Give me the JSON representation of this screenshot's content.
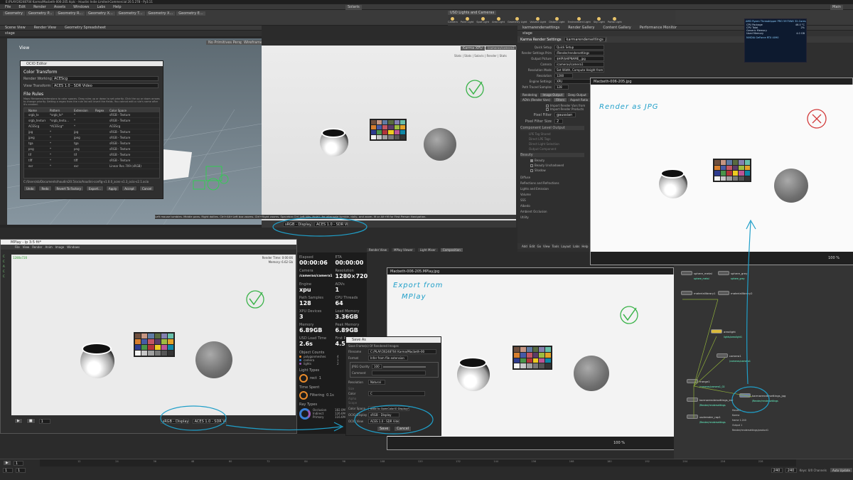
{
  "window": {
    "title": "E:/PLAY/26248704 Karma/Macbeth-006-205.hiplc - Houdini Indie Limited-Commercial 20.5.278 - Py3.11",
    "menus": [
      "File",
      "Edit",
      "Render",
      "Assets",
      "Windows",
      "Labs",
      "Help"
    ],
    "desktop": "Solaris",
    "build": "Main",
    "shelf_tabs": [
      "Geometry",
      "Geometry P...",
      "Geometry R...",
      "Geometry X...",
      "Geometry T...",
      "Geometry X...",
      "Geometry E..."
    ],
    "shelf_tabs_right": [
      "USD Lights and Cameras"
    ],
    "shelf_tools": [
      "Camera",
      "Point Light",
      "Spot Light",
      "Area Light",
      "Geometry Light",
      "Volume Light",
      "Distant Light",
      "Environment Light",
      "Sky Light",
      "Portal Light"
    ]
  },
  "top_left_pane": {
    "tabs": [
      "Scene View",
      "Render View",
      "Geometry Spreadsheet"
    ],
    "path": "stage",
    "view_label": "View",
    "hud_left": "No Primitives Persp",
    "hud_right": "Wireframe"
  },
  "ocio_editor": {
    "title": "OCIO Editor",
    "section": "Color Transform",
    "working_space_label": "Render Working Space",
    "working_space_value": "ACEScg",
    "view_transform_label": "View Transform",
    "view_transform_value": "ACES 1.0 - SDR Video",
    "file_rules_title": "File Rules",
    "file_rules_desc": "Maps filenames/extensions to color spaces. Drag rules up or down to set priority. Click the up or down arrows to change priority. Setting a regex from the rule list will invert the fields. You cannot edit a rule's name after it's created.",
    "columns": [
      "Name",
      "Pattern",
      "Extension",
      "Regex",
      "Color Space"
    ],
    "rules": [
      {
        "name": "srgb_tx",
        "pattern": "*srgb_tx*",
        "ext": "*",
        "regex": "",
        "cs": "sRGB - Texture"
      },
      {
        "name": "srgb_texture",
        "pattern": "*srgb_textu...",
        "ext": "*",
        "regex": "",
        "cs": "sRGB - Texture"
      },
      {
        "name": "ACEScg",
        "pattern": "*ACEScg*",
        "ext": "*",
        "regex": "",
        "cs": "ACEScg"
      },
      {
        "name": "jpg",
        "pattern": "*",
        "ext": "jpg",
        "regex": "",
        "cs": "sRGB - Texture"
      },
      {
        "name": "jpeg",
        "pattern": "*",
        "ext": "jpeg",
        "regex": "",
        "cs": "sRGB - Texture"
      },
      {
        "name": "tga",
        "pattern": "*",
        "ext": "tga",
        "regex": "",
        "cs": "sRGB - Texture"
      },
      {
        "name": "png",
        "pattern": "*",
        "ext": "png",
        "regex": "",
        "cs": "sRGB - Texture"
      },
      {
        "name": "tif",
        "pattern": "*",
        "ext": "tif",
        "regex": "",
        "cs": "sRGB - Texture"
      },
      {
        "name": "tiff",
        "pattern": "*",
        "ext": "tiff",
        "regex": "",
        "cs": "sRGB - Texture"
      },
      {
        "name": "exr",
        "pattern": "*",
        "ext": "exr",
        "regex": "",
        "cs": "Linear Rec.709 (sRGB)"
      }
    ],
    "config_path": "C:/Users/sb/Documents/houdini20.5/ocio/houdini-config-v1.0.0_aces-v1.3_ocio-v2.1.ocio",
    "buttons": [
      "Undo",
      "Redo",
      "Revert To Factory",
      "Export...",
      "Apply",
      "Accept",
      "Cancel"
    ]
  },
  "top_mid_viewport": {
    "camera": "/cameras/camera1",
    "renderer": "Karma XPU",
    "hud": "Stats | Stats | Solaris | Render | Stats",
    "status_text": "Left mouse tumbles. Middle pans. Right dollies. Ctrl+Alt+Left box zooms. Ctrl+Right zooms. Spacebar-Ctrl-Left tilts. Hold L for alternate tumble, dolly, and zoom. M or Alt+M for First Person Navigation.",
    "display": "sRGB - Display",
    "view": "ACES 1.0 - SDR Video",
    "frame": "1"
  },
  "parameters": {
    "tabs": [
      "karmarendersettings",
      "Render Gallery",
      "Content Gallery",
      "Performance Monitor"
    ],
    "path": "stage",
    "node_label": "Karma Render Settings",
    "node_name": "karmarendersettings_jpg",
    "fields": [
      {
        "label": "Quick Setup",
        "value": "Quick Setup"
      },
      {
        "label": "Render Settings Prim",
        "value": "/Render/rendersettings"
      },
      {
        "label": "Output Picture",
        "value": "$HIP/$HIPNAME_.jpg"
      },
      {
        "label": "Camera",
        "value": "/cameras/camera1"
      },
      {
        "label": "Resolution Mode",
        "value": "Set Width, Compute Height from Camera"
      },
      {
        "label": "Resolution",
        "value": "1280"
      },
      {
        "label": "Engine Settings",
        "value": "XPU"
      },
      {
        "label": "Path Traced Samples",
        "value": "128"
      }
    ],
    "resolution_h": "720",
    "subtabs": [
      "Rendering",
      "Image Output",
      "Deep Output",
      "Advanced"
    ],
    "subtabs2": [
      "AOVs (Render Vars)",
      "Filters",
      "Aspect Ratio",
      "Meta Data"
    ],
    "checks": [
      "Import Render Vars from",
      "Import Render Products"
    ],
    "pixel_filter_label": "Pixel Filter",
    "pixel_filter_value": "gaussian",
    "pixel_filter_size_label": "Pixel Filter Size",
    "pixel_filter_size": "2",
    "component_section": "Component Level Output",
    "lpe_items": [
      "LPE Tag Shared",
      "Direct LPE Tags",
      "Direct Light Selection",
      "Output Component"
    ],
    "beauty_section": "Beauty",
    "beauty_items": [
      "Beauty",
      "Beauty Unshadowed",
      "Shadow"
    ],
    "sections": [
      "Diffuse",
      "Reflections and Refractions",
      "Lights and Emission",
      "Volume",
      "SSS",
      "Albedo",
      "Ambient Occlusion",
      "Utility"
    ],
    "net_menus": [
      "Add",
      "Edit",
      "Go",
      "View",
      "Tools",
      "Layout",
      "Labs",
      "Help"
    ]
  },
  "gpu_overlay": {
    "title": "AMD Ryzen Threadripper PRO 5975WX 32-Cores",
    "lines": [
      "CPU Package",
      "CPU Total",
      "Generic Memory",
      "Used Memory"
    ],
    "gpu": "NVIDIA GeForce RTX 4090",
    "values": [
      "46.0 °C",
      "2%",
      "",
      "4.0 GB"
    ]
  },
  "photos_top": {
    "title": "Macbeth-006-205.jpg",
    "annotation": "Render as JPG",
    "zoom": "100 %"
  },
  "mplay": {
    "title": "MPlay - ip  3:5 fit*",
    "menus": [
      "File",
      "View",
      "Render",
      "Anim",
      "Image",
      "Windows"
    ],
    "tree": [
      "C",
      "C",
      "A",
      "C",
      "C"
    ],
    "res_label": "1280x720",
    "time_label": "Render Time: 0:00:06",
    "mem_label": "Memory: 6.62 Gb",
    "frame_label": "1",
    "display": "sRGB - Display",
    "view": "ACES 1.0 - SDR Video"
  },
  "render_stats": {
    "elapsed_label": "Elapsed",
    "elapsed": "00:00:06",
    "eta_label": "ETA",
    "eta": "00:00:00",
    "camera_label": "Camera",
    "camera": "/cameras/camera1",
    "resolution_label": "Resolution",
    "resolution": "1280×720",
    "engine_label": "Engine",
    "engine": "xpu",
    "aovs_label": "AOVs",
    "aovs": "1",
    "samples_label": "Path Samples",
    "samples": "128",
    "threads_label": "CPU Threads",
    "threads": "64",
    "gpus_label": "XPU Devices",
    "gpus": "3",
    "load_label": "Load Memory",
    "load": "3.36GB",
    "memory_label": "Memory",
    "memory": "6.89GB",
    "peak_label": "Peak Memory",
    "peak": "6.89GB",
    "usd_label": "USD Load Time",
    "usd": "2.6s",
    "first_label": "First Pixel",
    "first": "4.5s",
    "objects_label": "Object Counts",
    "objects": [
      {
        "name": "polygonmeshes",
        "value": "4"
      },
      {
        "name": "camera",
        "value": "1"
      },
      {
        "name": "lights",
        "value": "2"
      }
    ],
    "light_types_label": "Light Types",
    "light_type": "rect",
    "light_type_value": "1",
    "time_spent_label": "Time Spent",
    "time_spent_item": "Filtering",
    "time_spent_value": "0.1s",
    "ray_types_label": "Ray Types",
    "ray_types": [
      {
        "name": "Occlusion",
        "value": "182.0M"
      },
      {
        "name": "Indirect",
        "value": "126.6M"
      },
      {
        "name": "Primary",
        "value": "116.6M"
      }
    ]
  },
  "tabs_mid": [
    "Render View",
    "MPlay Viewer",
    "Light Mixer",
    "Composition"
  ],
  "photos_bottom": {
    "title": "Macbeth-006-205.MPlay.jpg",
    "annotation_line1": "Export from",
    "annotation_line2": "MPlay",
    "zoom": "100 %"
  },
  "save_as": {
    "title": "Save As",
    "subtitle": "Save Frame(s) Of Rendered Images",
    "filename_label": "Filename",
    "filename": "C:/PLAY/26248704 Karma/Macbeth-00",
    "format_label": "Format",
    "format": "Infer from file extension",
    "quality_label": "JPEG Quality",
    "quality": "100",
    "comment_label": "Comment",
    "resolution_label": "Resolution",
    "resolution": "Natural",
    "size_label": "Size",
    "color_label": "Color",
    "color": "C",
    "alpha_label": "Alpha",
    "scope_label": "Scope",
    "colorspace_label": "Color Space",
    "colorspace": "Bake to OpenColorIO Display/View",
    "ocio_display_label": "OCIO Display",
    "ocio_display": "sRGB - Display",
    "ocio_view_label": "OCIO View",
    "ocio_view": "ACES 1.0 - SDR Video",
    "save": "Save",
    "cancel": "Cancel"
  },
  "network": {
    "nodes": [
      {
        "name": "sphere_metal",
        "sub": "sphere_metal"
      },
      {
        "name": "sphere_grey",
        "sub": "sphere_grey"
      },
      {
        "name": "materiallibrary1",
        "sub": ""
      },
      {
        "name": "materiallibrary2",
        "sub": ""
      },
      {
        "name": "arealight",
        "sub": "lights/arealight1"
      },
      {
        "name": "camera1",
        "sub": "/cameras/camera1"
      },
      {
        "name": "merge1",
        "sub": "/cameras/camera1_02"
      },
      {
        "name": "karmarendersettings_exr",
        "sub": "/Render/rendersettings"
      },
      {
        "name": "karmarendersettings_jpg",
        "sub": "/Render/rendersettings"
      },
      {
        "name": "usdrender_rop1",
        "sub": "/Render/rendersettings"
      }
    ],
    "node_info": [
      "Houdini",
      "Karma",
      "frame 1-240",
      "Output 1",
      "Render/rendersettings/product1"
    ]
  },
  "timeline": {
    "frame": "1",
    "start": "1",
    "end": "240",
    "end2": "240",
    "ticks": [
      "12",
      "24",
      "36",
      "48",
      "60",
      "72",
      "84",
      "96",
      "108",
      "120",
      "132",
      "144",
      "156",
      "168",
      "180",
      "192",
      "204",
      "216",
      "228"
    ],
    "status": "Keys: 0/0 Channels",
    "auto_update": "Auto Update"
  },
  "chart_colors": {
    "teal_ink": "#1f9fc9",
    "green_ink": "#3bb34a",
    "red_ink": "#d23a3a"
  },
  "checker_colors": [
    "#6f4f3e",
    "#c59582",
    "#5e7aa3",
    "#596b40",
    "#8480b0",
    "#67bfa9",
    "#d77e2e",
    "#465aa6",
    "#c35663",
    "#5b3c68",
    "#9dbc40",
    "#e3a228",
    "#2e3c8f",
    "#4a944a",
    "#b23439",
    "#eecb21",
    "#bb5495",
    "#0f87a6",
    "#f3f3f2",
    "#c8c8c8",
    "#a0a0a0",
    "#7a7a79",
    "#555555",
    "#343434"
  ]
}
